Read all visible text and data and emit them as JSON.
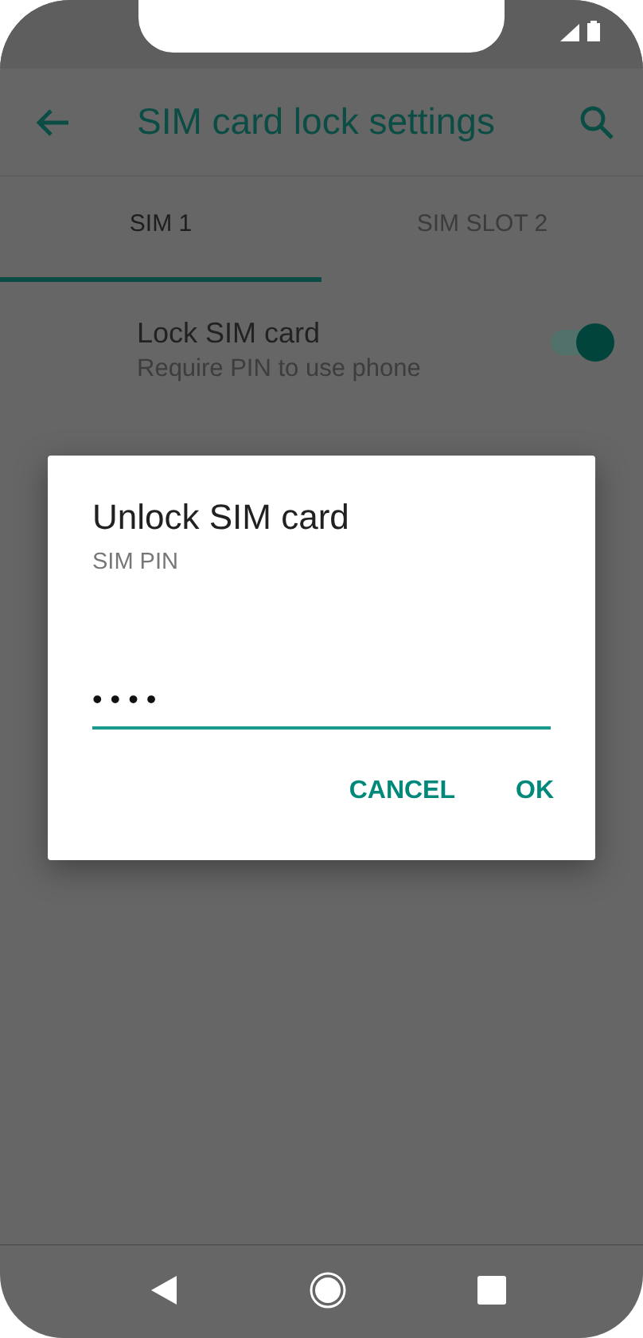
{
  "app_bar": {
    "title": "SIM card lock settings"
  },
  "tabs": [
    {
      "label": "SIM 1",
      "selected": true
    },
    {
      "label": "SIM SLOT 2",
      "selected": false
    }
  ],
  "lock_setting": {
    "title": "Lock SIM card",
    "summary": "Require PIN to use phone",
    "on": true
  },
  "dialog": {
    "title": "Unlock SIM card",
    "subtitle": "SIM PIN",
    "pin_value": "••••",
    "buttons": [
      "CANCEL",
      "OK"
    ]
  }
}
